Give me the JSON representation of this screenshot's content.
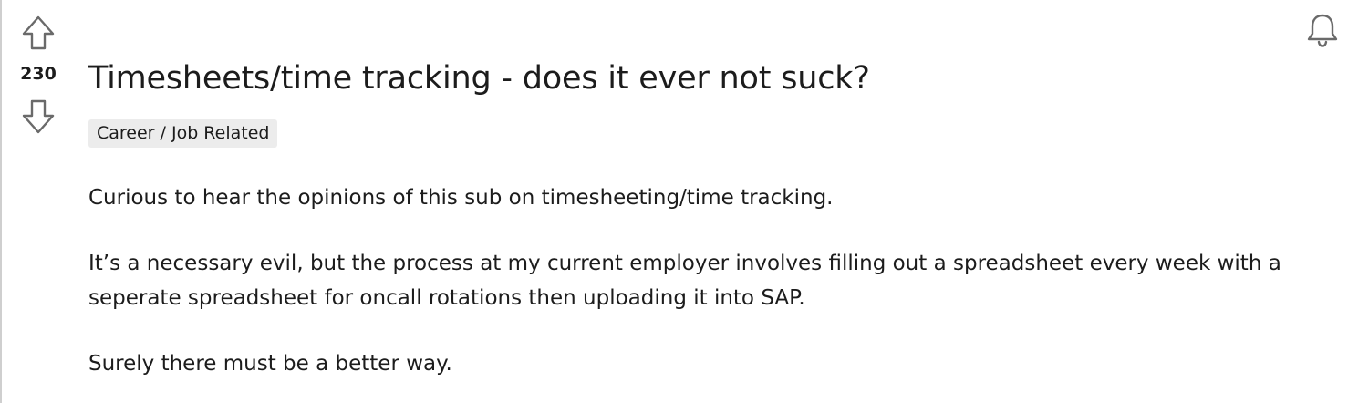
{
  "post": {
    "vote_count": "230",
    "title": "Timesheets/time tracking - does it ever not suck?",
    "flair": "Career / Job Related",
    "paragraphs": [
      "Curious to hear the opinions of this sub on timesheeting/time tracking.",
      "It’s a necessary evil, but the process at my current employer involves filling out a spreadsheet every week with a seperate spreadsheet for oncall rotations then uploading it into SAP.",
      "Surely there must be a better way."
    ]
  },
  "icons": {
    "upvote": "arrow-up-outline-icon",
    "downvote": "arrow-down-outline-icon",
    "notifications": "bell-icon"
  },
  "colors": {
    "text": "#1c1c1c",
    "flair_bg": "#ececec",
    "icon_stroke": "#6a6a6a"
  }
}
